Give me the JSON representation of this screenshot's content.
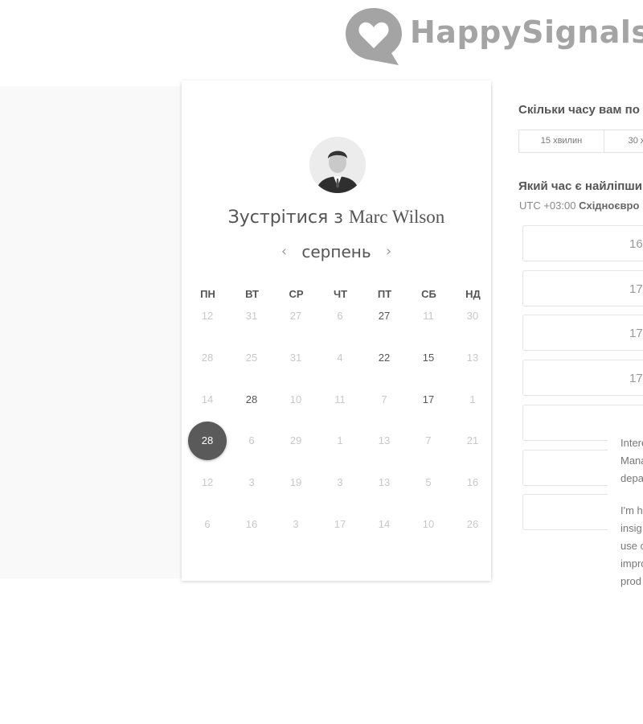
{
  "brand": {
    "name": "HappySignals"
  },
  "meeting": {
    "title": "Зустрітися з",
    "host": "Marc Wilson"
  },
  "calendar": {
    "month": "серпень",
    "prev_icon": "‹",
    "next_icon": "›",
    "weekdays": [
      "ПН",
      "ВТ",
      "СР",
      "ЧТ",
      "ПТ",
      "СБ",
      "НД"
    ],
    "weeks": [
      [
        {
          "d": "12",
          "s": "off"
        },
        {
          "d": "31",
          "s": "off"
        },
        {
          "d": "27",
          "s": "off"
        },
        {
          "d": "6",
          "s": "off"
        },
        {
          "d": "27",
          "s": "on"
        },
        {
          "d": "11",
          "s": "off"
        },
        {
          "d": "30",
          "s": "off"
        }
      ],
      [
        {
          "d": "28",
          "s": "off"
        },
        {
          "d": "25",
          "s": "off"
        },
        {
          "d": "31",
          "s": "off"
        },
        {
          "d": "4",
          "s": "off"
        },
        {
          "d": "22",
          "s": "on"
        },
        {
          "d": "15",
          "s": "on"
        },
        {
          "d": "13",
          "s": "off"
        }
      ],
      [
        {
          "d": "14",
          "s": "off"
        },
        {
          "d": "28",
          "s": "on"
        },
        {
          "d": "10",
          "s": "off"
        },
        {
          "d": "11",
          "s": "off"
        },
        {
          "d": "7",
          "s": "off"
        },
        {
          "d": "17",
          "s": "on"
        },
        {
          "d": "1",
          "s": "off"
        }
      ],
      [
        {
          "d": "28",
          "s": "selected"
        },
        {
          "d": "6",
          "s": "off"
        },
        {
          "d": "29",
          "s": "off"
        },
        {
          "d": "1",
          "s": "off"
        },
        {
          "d": "13",
          "s": "off"
        },
        {
          "d": "7",
          "s": "off"
        },
        {
          "d": "21",
          "s": "off"
        }
      ],
      [
        {
          "d": "12",
          "s": "off"
        },
        {
          "d": "3",
          "s": "off"
        },
        {
          "d": "19",
          "s": "off"
        },
        {
          "d": "3",
          "s": "off"
        },
        {
          "d": "13",
          "s": "off"
        },
        {
          "d": "5",
          "s": "off"
        },
        {
          "d": "16",
          "s": "off"
        }
      ],
      [
        {
          "d": "6",
          "s": "off"
        },
        {
          "d": "16",
          "s": "off"
        },
        {
          "d": "3",
          "s": "off"
        },
        {
          "d": "17",
          "s": "off"
        },
        {
          "d": "14",
          "s": "off"
        },
        {
          "d": "10",
          "s": "off"
        },
        {
          "d": "26",
          "s": "off"
        }
      ]
    ]
  },
  "duration": {
    "question": "Скільки часу вам по",
    "options": [
      "15 хвилин",
      "30 х"
    ]
  },
  "time": {
    "question": "Який час є найліпши",
    "tz_offset": "UTC +03:00",
    "tz_name": "Східноєвро",
    "slots": [
      "16",
      "17",
      "17",
      "17",
      "",
      "",
      ""
    ]
  },
  "popup": {
    "paragraphs": [
      "Intere\nMana\ndepa",
      "I'm h\ninsig\nuse c\nimpro\nprod"
    ]
  },
  "colors": {
    "selected_day": "#5a5a5a",
    "logo": "#a4a4a4"
  }
}
